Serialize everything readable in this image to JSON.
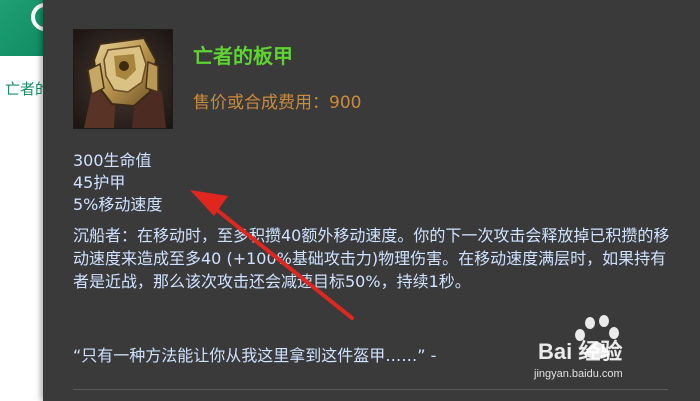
{
  "background": {
    "title": "亡者的板"
  },
  "item": {
    "name": "亡者的板甲",
    "price_line": "售价或合成费用：900",
    "stats": [
      "300生命值",
      "45护甲",
      "5%移动速度"
    ],
    "passive_text": "沉船者：在移动时，至多积攒40额外移动速度。你的下一次攻击会释放掉已积攒的移动速度来造成至多40 (+100%基础攻击力)物理伤害。在移动速度满层时，如果持有者是近战，那么该次攻击还会减速目标50%，持续1秒。",
    "quote": "“只有一种方法能让你从我这里拿到这件盔甲……” -"
  },
  "watermark": {
    "brand": "Bai 经验",
    "url": "jingyan.baidu.com"
  },
  "colors": {
    "item_name": "#5fd332",
    "price": "#c98b3a",
    "body_text": "#cfe2ff",
    "tooltip_bg": "#3a3a3a",
    "arrow": "#e0271f"
  }
}
